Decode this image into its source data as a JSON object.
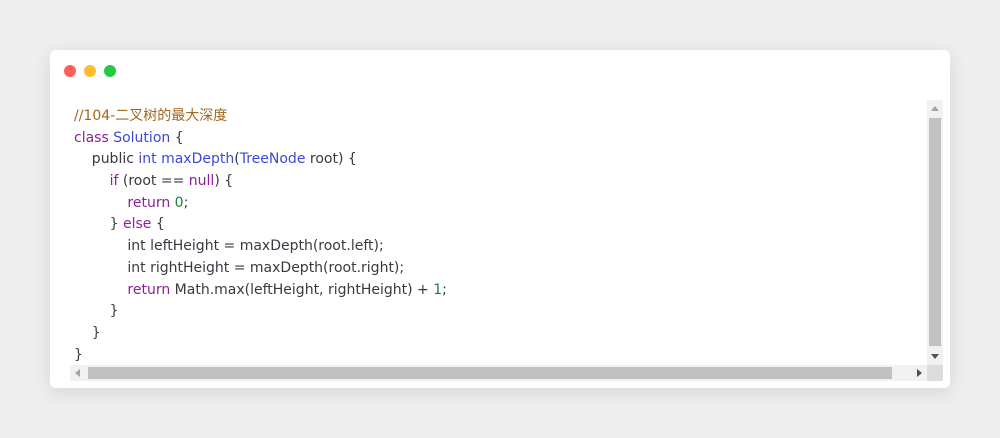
{
  "window": {
    "controls": [
      {
        "name": "close",
        "color": "#ff5f57"
      },
      {
        "name": "minimize",
        "color": "#febc2e"
      },
      {
        "name": "maximize",
        "color": "#28c840"
      }
    ]
  },
  "code": {
    "lines": [
      [
        {
          "t": "//104-二叉树的最大深度",
          "c": "comment"
        }
      ],
      [
        {
          "t": "class",
          "c": "keyword"
        },
        {
          "t": " ",
          "c": "plain"
        },
        {
          "t": "Solution",
          "c": "type"
        },
        {
          "t": " {",
          "c": "plain"
        }
      ],
      [
        {
          "t": "    public ",
          "c": "plain"
        },
        {
          "t": "int",
          "c": "type"
        },
        {
          "t": " ",
          "c": "plain"
        },
        {
          "t": "maxDepth",
          "c": "method"
        },
        {
          "t": "(",
          "c": "plain"
        },
        {
          "t": "TreeNode",
          "c": "type"
        },
        {
          "t": " root) {",
          "c": "plain"
        }
      ],
      [
        {
          "t": "        ",
          "c": "plain"
        },
        {
          "t": "if",
          "c": "keyword"
        },
        {
          "t": " (root == ",
          "c": "plain"
        },
        {
          "t": "null",
          "c": "keyword"
        },
        {
          "t": ") {",
          "c": "plain"
        }
      ],
      [
        {
          "t": "            ",
          "c": "plain"
        },
        {
          "t": "return",
          "c": "keyword"
        },
        {
          "t": " ",
          "c": "plain"
        },
        {
          "t": "0",
          "c": "number"
        },
        {
          "t": ";",
          "c": "plain"
        }
      ],
      [
        {
          "t": "        } ",
          "c": "plain"
        },
        {
          "t": "else",
          "c": "keyword"
        },
        {
          "t": " {",
          "c": "plain"
        }
      ],
      [
        {
          "t": "            int leftHeight = maxDepth(root.left);",
          "c": "plain"
        }
      ],
      [
        {
          "t": "            int rightHeight = maxDepth(root.right);",
          "c": "plain"
        }
      ],
      [
        {
          "t": "            ",
          "c": "plain"
        },
        {
          "t": "return",
          "c": "keyword"
        },
        {
          "t": " Math.max(leftHeight, rightHeight) + ",
          "c": "plain"
        },
        {
          "t": "1",
          "c": "number"
        },
        {
          "t": ";",
          "c": "plain"
        }
      ],
      [
        {
          "t": "        }",
          "c": "plain"
        }
      ],
      [
        {
          "t": "    }",
          "c": "plain"
        }
      ],
      [
        {
          "t": "}",
          "c": "plain"
        }
      ]
    ]
  }
}
